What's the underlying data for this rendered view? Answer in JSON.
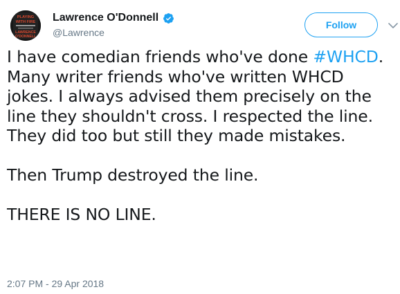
{
  "colors": {
    "link": "#1da1f2",
    "text": "#14171a",
    "muted": "#657786"
  },
  "author": {
    "display_name": "Lawrence O'Donnell",
    "handle": "@Lawrence",
    "verified": true,
    "avatar_icon": "book-cover-avatar",
    "avatar_text_lines": [
      "PLAYING",
      "WITH FIRE",
      "LAWRENCE",
      "O'DONNELL"
    ]
  },
  "actions": {
    "follow_label": "Follow",
    "menu_icon": "chevron-down-icon"
  },
  "tweet": {
    "line1_prefix": "I have comedian friends who've done ",
    "hashtag": "#WHCD",
    "line1_suffix": ". Many writer friends who've written WHCD jokes. I always advised them precisely on the line they shouldn't cross. I respected the line. They did too but still they made mistakes.",
    "paragraph2": "Then Trump destroyed the line.",
    "paragraph3": "THERE IS NO LINE."
  },
  "timestamp": "2:07 PM - 29 Apr 2018"
}
